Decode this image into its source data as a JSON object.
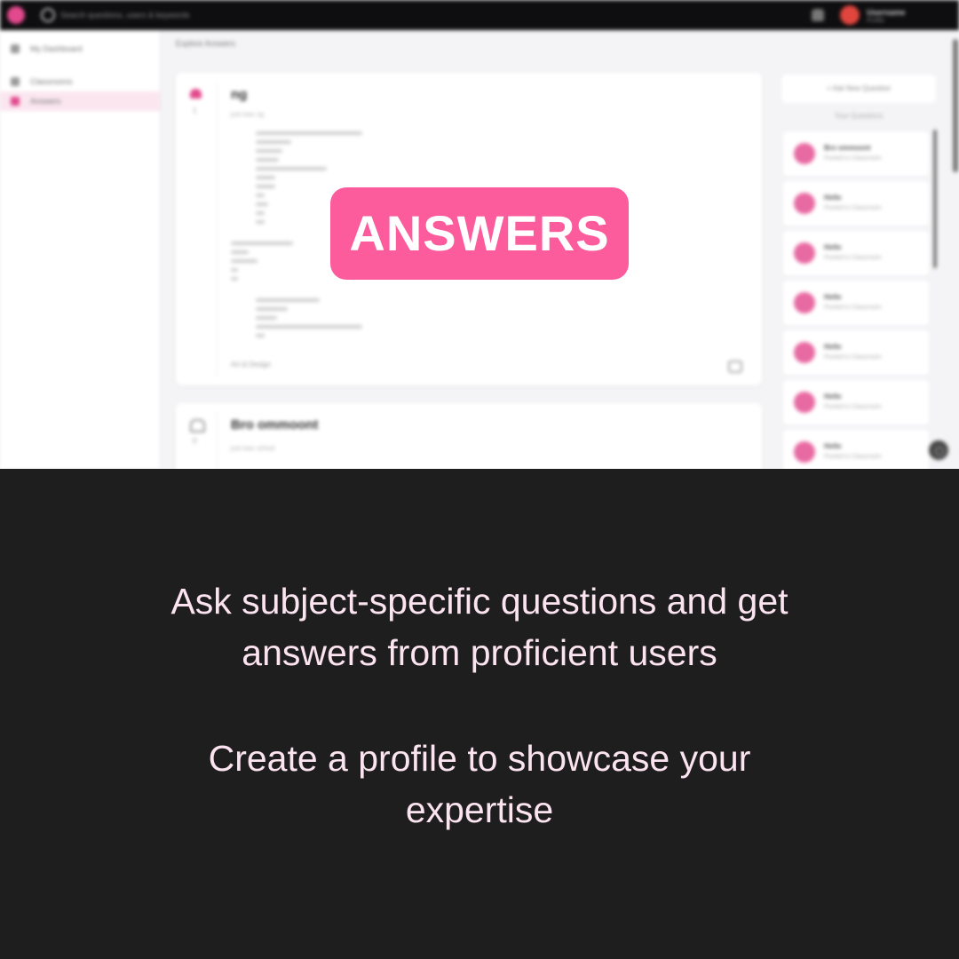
{
  "overlay": {
    "badge": "ANSWERS",
    "caption_line1": "Ask subject-specific questions and get",
    "caption_line2": "answers from proficient users",
    "caption_line3": "Create a profile to showcase your",
    "caption_line4": "expertise"
  },
  "colors": {
    "badge_bg": "#fd5c9c",
    "caption_text": "#fbe3f0",
    "background": "#1e1e1e",
    "accent": "#e24a8d"
  },
  "app": {
    "search_placeholder": "Search questions, users & keywords",
    "user_name": "Username",
    "user_subtitle": "Profile",
    "sidebar": [
      {
        "label": "My Dashboard",
        "icon": "dashboard-icon"
      },
      {
        "label": "Classrooms",
        "icon": "classroom-icon"
      },
      {
        "label": "Answers",
        "icon": "answers-icon"
      }
    ],
    "breadcrumb": "Explore Answers",
    "questions": [
      {
        "title": "ng",
        "votes": "1",
        "meta": "just now, ng",
        "tag": "Art & Design",
        "liked": true
      },
      {
        "title": "Bro ommoont",
        "votes": "0",
        "meta": "just now, school",
        "tag": "",
        "liked": false
      }
    ],
    "ask_button": "+ Ask New Question",
    "your_questions_label": "Your Questions",
    "your_questions": [
      {
        "title": "Bro ommoont",
        "subtitle": "Posted in Classroom"
      },
      {
        "title": "Hello",
        "subtitle": "Posted in Classroom"
      },
      {
        "title": "Hello",
        "subtitle": "Posted in Classroom"
      },
      {
        "title": "Hello",
        "subtitle": "Posted in Classroom"
      },
      {
        "title": "Hello",
        "subtitle": "Posted in Classroom"
      },
      {
        "title": "Hello",
        "subtitle": "Posted in Classroom"
      },
      {
        "title": "Hello",
        "subtitle": "Posted in Classroom"
      }
    ]
  }
}
